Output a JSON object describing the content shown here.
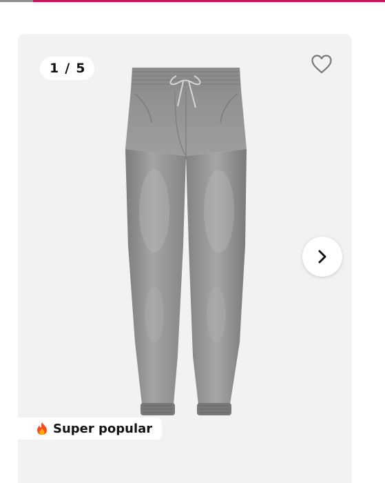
{
  "gallery": {
    "counter": {
      "current": "1",
      "separator": "/",
      "total": "5"
    },
    "badge": {
      "icon": "fire-icon",
      "label": "Super popular"
    },
    "favorite_icon": "heart-outline-icon",
    "next_icon": "chevron-right-icon",
    "product_image": "grey-denim-jogger-jeans"
  },
  "colors": {
    "accent_bar": "#c2185b",
    "card_background": "#f2f2f2"
  }
}
